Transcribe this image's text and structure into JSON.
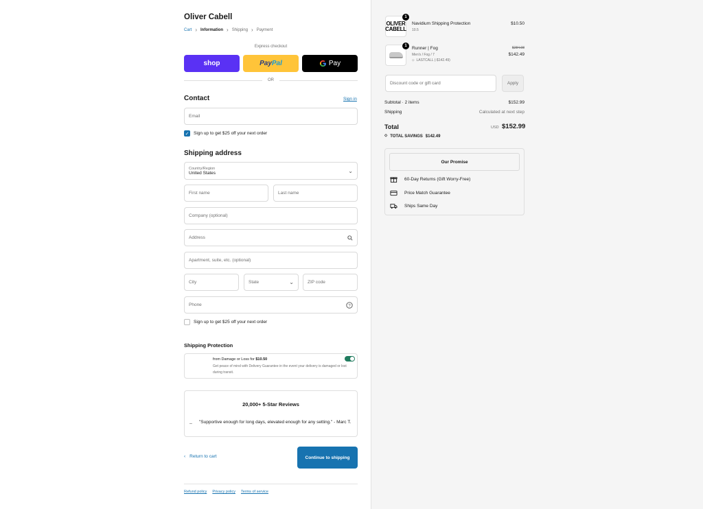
{
  "store": {
    "name": "Oliver Cabell"
  },
  "breadcrumb": {
    "cart": "Cart",
    "information": "Information",
    "shipping": "Shipping",
    "payment": "Payment"
  },
  "express": {
    "label": "Express checkout",
    "shop_label": "shop",
    "paypal_label_1": "Pay",
    "paypal_label_2": "Pal",
    "gpay_label": "Pay",
    "or": "OR"
  },
  "contact": {
    "title": "Contact",
    "signin": "Sign in",
    "email_placeholder": "Email",
    "newsletter": "Sign up to get $25 off your next order",
    "newsletter_checked": true
  },
  "shipping_address": {
    "title": "Shipping address",
    "country_label": "Country/Region",
    "country_value": "United States",
    "first_name": "First name",
    "last_name": "Last name",
    "company": "Company (optional)",
    "address": "Address",
    "apartment": "Apartment, suite, etc. (optional)",
    "city": "City",
    "state": "State",
    "zip": "ZIP code",
    "phone": "Phone",
    "sms_signup": "Sign up to get $25 off your next order",
    "sms_checked": false
  },
  "protection": {
    "title": "Shipping Protection",
    "line1_prefix": "from Damage or Loss for",
    "line1_price": "$10.50",
    "line2": "Get peace of mind with Delivery Guarantee in the event your delivery is damaged or lost during transit.",
    "enabled": true
  },
  "reviews": {
    "title": "20,000+ 5-Star Reviews",
    "dash": "–",
    "quote": "\"Supportive enough for long days, elevated enough for any setting.\" - Marc T."
  },
  "actions": {
    "back": "Return to cart",
    "continue": "Continue to shipping"
  },
  "footer": {
    "refund": "Refund policy",
    "privacy": "Privacy policy",
    "terms": "Terms of service"
  },
  "cart": {
    "items": [
      {
        "logo_line1": "OLIVER",
        "logo_line2": "CABELL",
        "qty": "1",
        "name": "Navidium Shipping Protection",
        "variant": "10.5",
        "price": "$10.50"
      },
      {
        "qty": "1",
        "name": "Runner | Fog",
        "variant": "Men's / Fog / 7",
        "discount": "LASTCALL (-$142.49)",
        "original_price": "$284.98",
        "price": "$142.49"
      }
    ],
    "discount_placeholder": "Discount code or gift card",
    "apply": "Apply",
    "subtotal_label": "Subtotal · 2 items",
    "subtotal_value": "$152.99",
    "shipping_label": "Shipping",
    "shipping_value": "Calculated at next step",
    "total_label": "Total",
    "currency": "USD",
    "total_value": "$152.99",
    "savings_label": "TOTAL SAVINGS",
    "savings_value": "$142.49"
  },
  "promise": {
    "title": "Our Promise",
    "items": [
      "60-Day Returns (Gift Worry-Free)",
      "Price Match Guarantee",
      "Ships Same Day"
    ]
  },
  "colors": {
    "accent": "#1773b0",
    "shop": "#5a31f4",
    "paypal": "#ffc439",
    "toggle": "#217c5f"
  }
}
